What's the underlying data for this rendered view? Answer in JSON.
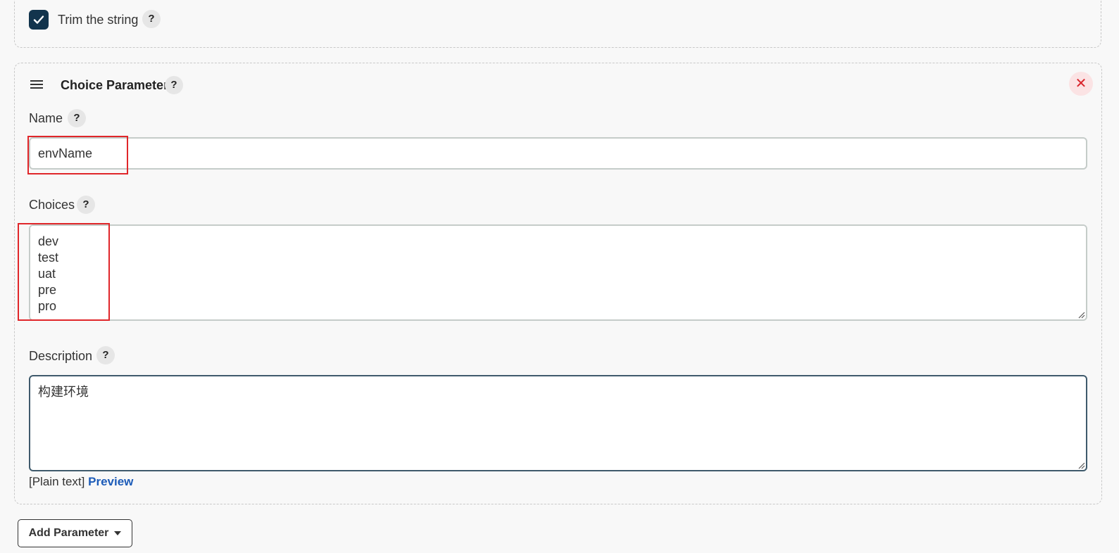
{
  "trim_section": {
    "checked": true,
    "label": "Trim the string",
    "help_glyph": "?"
  },
  "choice_parameter": {
    "title": "Choice Parameter",
    "help_glyph": "?",
    "close_glyph": "✕",
    "name_field": {
      "label": "Name",
      "value": "envName"
    },
    "choices_field": {
      "label": "Choices",
      "value": "dev\ntest\nuat\npre\npro"
    },
    "description_field": {
      "label": "Description",
      "value": "构建环境"
    },
    "format": {
      "plain_text": "[Plain text]",
      "preview_link": "Preview"
    }
  },
  "add_parameter": {
    "label": "Add Parameter"
  },
  "colors": {
    "checkbox_bg": "#12344d",
    "highlight_border": "#e0262a",
    "close_bg": "#fbe3e4",
    "close_fg": "#d9252c",
    "link": "#1c5bb8"
  },
  "icons": {
    "drag_handle": "hamburger-icon",
    "help": "question-icon",
    "close": "close-icon",
    "checkbox": "checkmark-icon",
    "dropdown": "caret-down-icon"
  }
}
